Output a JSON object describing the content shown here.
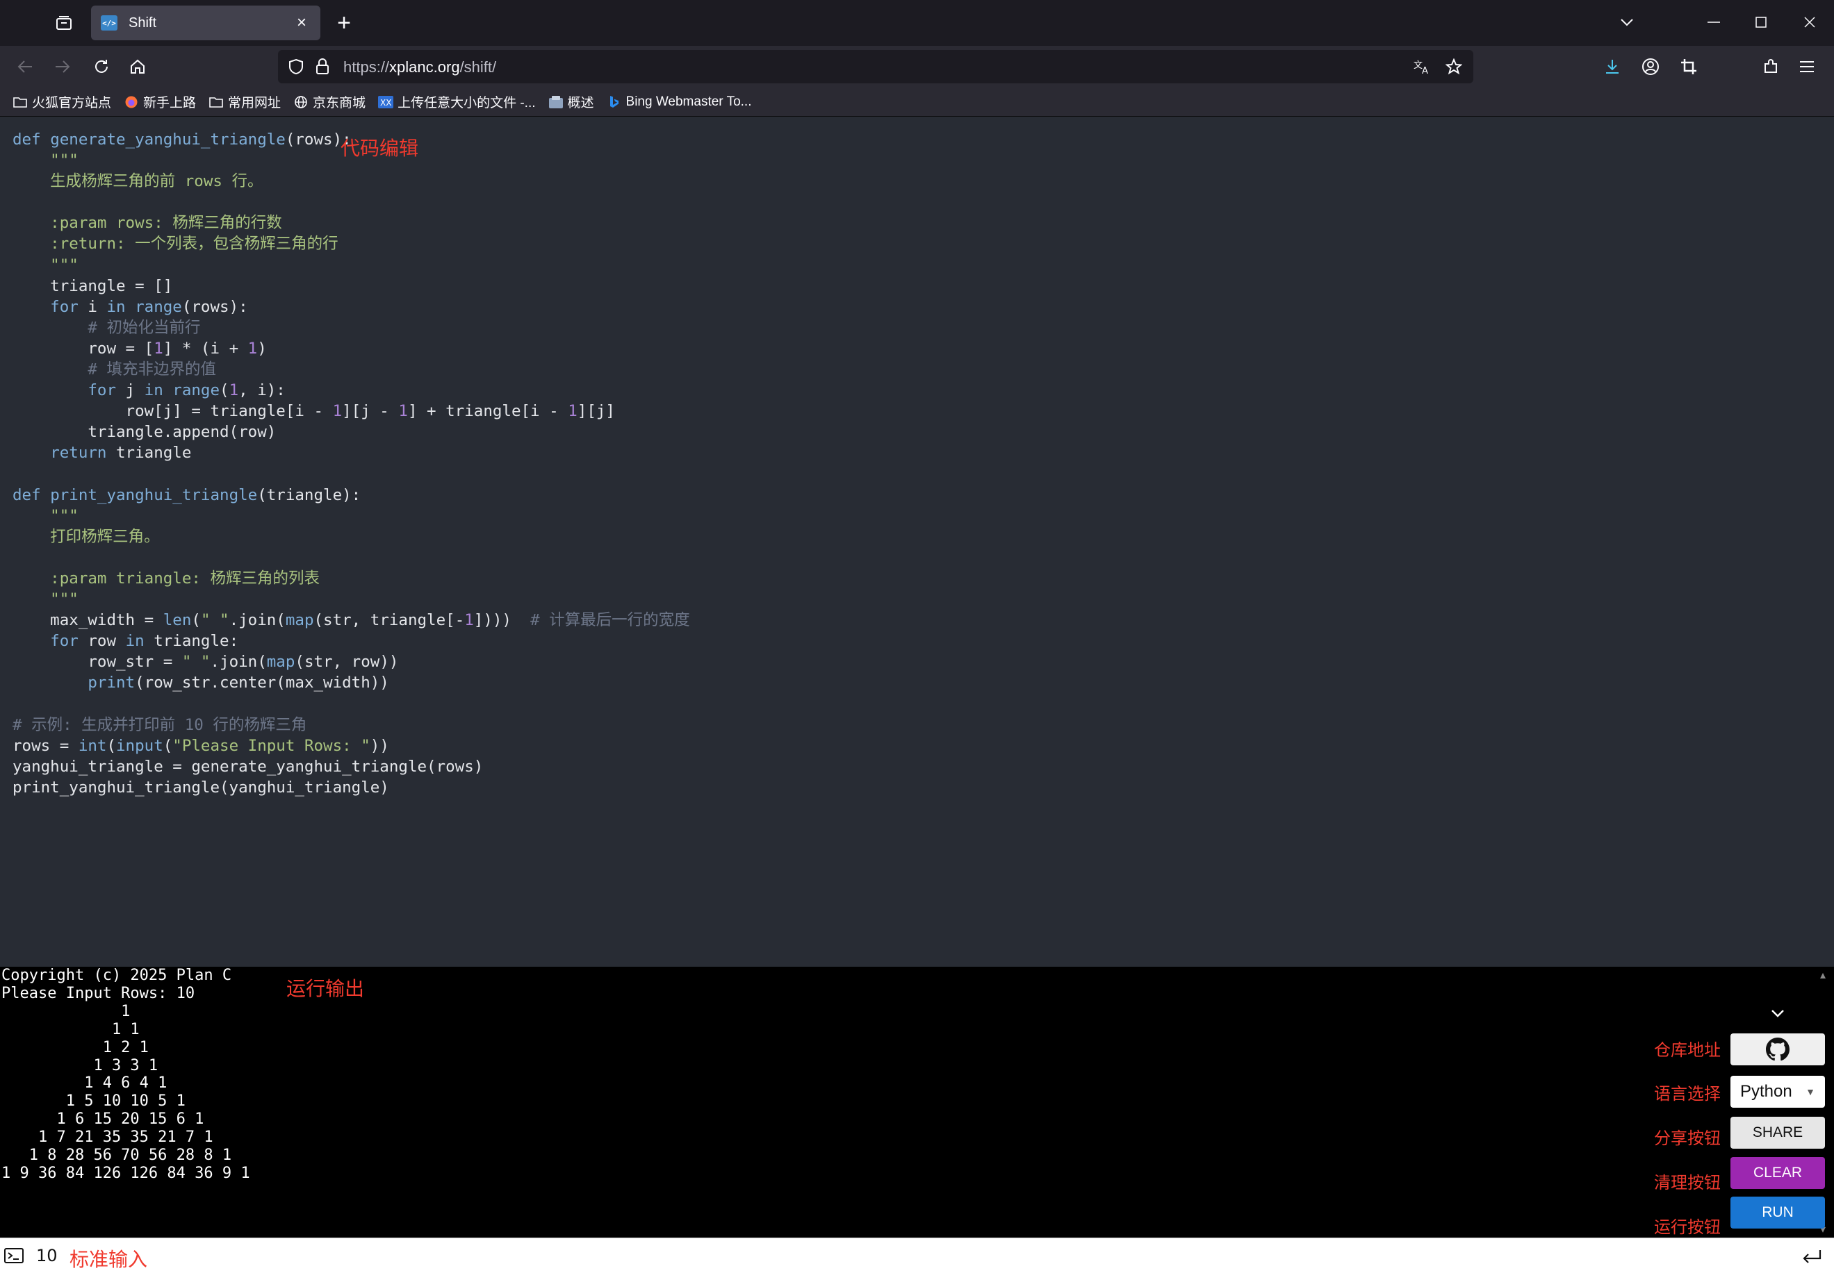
{
  "tab": {
    "title": "Shift",
    "favicon_text": "</>"
  },
  "url": {
    "prefix": "https://",
    "domain": "xplanc.org",
    "path": "/shift/"
  },
  "bookmarks": [
    {
      "label": "火狐官方站点",
      "icon": "folder-icon"
    },
    {
      "label": "新手上路",
      "icon": "firefox-icon"
    },
    {
      "label": "常用网址",
      "icon": "folder-icon"
    },
    {
      "label": "京东商城",
      "icon": "globe-icon"
    },
    {
      "label": "上传任意大小的文件 -...",
      "icon": "upload-site-icon"
    },
    {
      "label": "概述",
      "icon": "site-icon"
    },
    {
      "label": "Bing Webmaster To...",
      "icon": "bing-icon"
    }
  ],
  "annotations": {
    "editor": "代码编辑",
    "output": "运行输出",
    "repo": "仓库地址",
    "language": "语言选择",
    "share": "分享按钮",
    "clear": "清理按钮",
    "run": "运行按钮",
    "stdin": "标准输入"
  },
  "controls": {
    "language": "Python",
    "share": "SHARE",
    "clear": "CLEAR",
    "run": "RUN"
  },
  "stdin": {
    "value": "10"
  },
  "code": [
    "def generate_yanghui_triangle(rows):",
    "    \"\"\"",
    "    生成杨辉三角的前 rows 行。",
    "",
    "    :param rows: 杨辉三角的行数",
    "    :return: 一个列表，包含杨辉三角的行",
    "    \"\"\"",
    "    triangle = []",
    "    for i in range(rows):",
    "        # 初始化当前行",
    "        row = [1] * (i + 1)",
    "        # 填充非边界的值",
    "        for j in range(1, i):",
    "            row[j] = triangle[i - 1][j - 1] + triangle[i - 1][j]",
    "        triangle.append(row)",
    "    return triangle",
    "",
    "def print_yanghui_triangle(triangle):",
    "    \"\"\"",
    "    打印杨辉三角。",
    "",
    "    :param triangle: 杨辉三角的列表",
    "    \"\"\"",
    "    max_width = len(\" \".join(map(str, triangle[-1])))  # 计算最后一行的宽度",
    "    for row in triangle:",
    "        row_str = \" \".join(map(str, row))",
    "        print(row_str.center(max_width))",
    "",
    "# 示例: 生成并打印前 10 行的杨辉三角",
    "rows = int(input(\"Please Input Rows: \"))",
    "yanghui_triangle = generate_yanghui_triangle(rows)",
    "print_yanghui_triangle(yanghui_triangle)"
  ],
  "output": [
    "Copyright (c) 2025 Plan C",
    "Please Input Rows: 10",
    "             1",
    "            1 1",
    "           1 2 1",
    "          1 3 3 1",
    "         1 4 6 4 1",
    "       1 5 10 10 5 1",
    "      1 6 15 20 15 6 1",
    "    1 7 21 35 35 21 7 1",
    "   1 8 28 56 70 56 28 8 1",
    "1 9 36 84 126 126 84 36 9 1"
  ]
}
